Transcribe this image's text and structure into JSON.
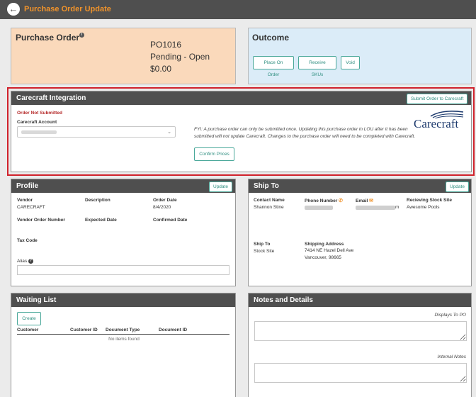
{
  "topbar": {
    "title": "Purchase Order Update",
    "back_icon": "back-arrow-icon"
  },
  "purchase_order": {
    "title": "Purchase Order",
    "info_icon": "i",
    "number": "PO1016",
    "status": "Pending - Open",
    "amount": "$0.00"
  },
  "outcome": {
    "title": "Outcome",
    "buttons": [
      "Place On Order",
      "Receive SKUs",
      "Void"
    ]
  },
  "carecraft": {
    "title": "Carecraft Integration",
    "submit_label": "Submit Order to Carecraft",
    "status": "Order Not Submitted",
    "account_label": "Carecraft Account",
    "account_value": "",
    "fyi": "FYI: A purchase order can only be submitted once. Updating this purchase order in LOU after it has been submitted will not update Carecraft. Changes to the purchase order will need to be completed with Carecraft.",
    "confirm_label": "Confirm Prices",
    "logo_text": "Carecraft",
    "brand_color": "#1e3b6e"
  },
  "profile": {
    "title": "Profile",
    "update_label": "Update",
    "vendor_label": "Vendor",
    "vendor_value": "CARECRAFT",
    "description_label": "Description",
    "order_date_label": "Order Date",
    "order_date_value": "8/4/2020",
    "vendor_order_number_label": "Vendor Order Number",
    "expected_date_label": "Expected Date",
    "confirmed_date_label": "Confirmed Date",
    "tax_code_label": "Tax Code",
    "alias_label": "Alias",
    "alias_value": ""
  },
  "ship_to": {
    "title": "Ship To",
    "update_label": "Update",
    "contact_name_label": "Contact Name",
    "contact_name_value": "Shannon Stine",
    "phone_label": "Phone Number",
    "email_label": "Email",
    "email_suffix": "m",
    "stock_site_label": "Recieving Stock Site",
    "stock_site_value": "Awesome Pools",
    "ship_to_label": "Ship To",
    "ship_to_value": "Stock Site",
    "address_label": "Shipping Address",
    "address_line1": "7414 NE Hazel Dell Ave",
    "address_line2": "Vancouver, 98665"
  },
  "waiting_list": {
    "title": "Waiting List",
    "create_label": "Create",
    "columns": [
      "Customer",
      "Customer ID",
      "Document Type",
      "Document ID"
    ],
    "empty_message": "No items found"
  },
  "notes": {
    "title": "Notes and Details",
    "po_label": "Displays To PO",
    "internal_label": "Internal Notes"
  },
  "colors": {
    "header_bg": "#4f4f4f",
    "title_accent": "#f0932b",
    "po_card_bg": "#fad9bb",
    "outcome_card_bg": "#dbecf8",
    "button_teal": "#2f8f80",
    "highlight_red": "#d0212b",
    "error_red": "#b52a2a"
  }
}
